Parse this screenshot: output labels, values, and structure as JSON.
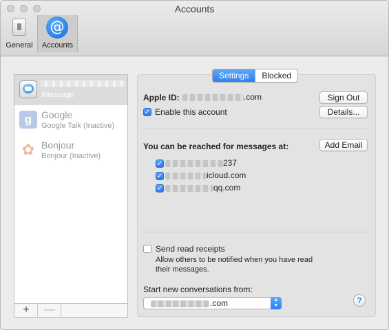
{
  "window": {
    "title": "Accounts"
  },
  "toolbar": {
    "general_label": "General",
    "accounts_label": "Accounts"
  },
  "accounts": [
    {
      "name": "",
      "type": "iMessage",
      "icon": "imessage-icon"
    },
    {
      "name": "Google",
      "type": "Google Talk (Inactive)",
      "icon": "google-icon"
    },
    {
      "name": "Bonjour",
      "type": "Bonjour (Inactive)",
      "icon": "bonjour-icon"
    }
  ],
  "list_buttons": {
    "add": "+",
    "remove": "—"
  },
  "tabs": {
    "settings": "Settings",
    "blocked": "Blocked"
  },
  "settings": {
    "apple_id_label": "Apple ID:",
    "apple_id_suffix": ".com",
    "enable_label": "Enable this account",
    "enable_checked": true,
    "sign_out": "Sign Out",
    "details": "Details...",
    "reach_label": "You can be reached for messages at:",
    "add_email": "Add Email",
    "addresses": [
      {
        "suffix": "237",
        "checked": true
      },
      {
        "suffix": "icloud.com",
        "checked": true
      },
      {
        "suffix": "qq.com",
        "checked": true
      }
    ],
    "read_receipts_label": "Send read receipts",
    "read_receipts_checked": false,
    "read_receipts_desc_1": "Allow others to be notified when you have read",
    "read_receipts_desc_2": "their messages.",
    "start_from_label": "Start new conversations from:",
    "start_from_suffix": ".com",
    "help": "?"
  },
  "colors": {
    "accent": "#2e7ff0",
    "selected_row": "#dcdcdc"
  }
}
